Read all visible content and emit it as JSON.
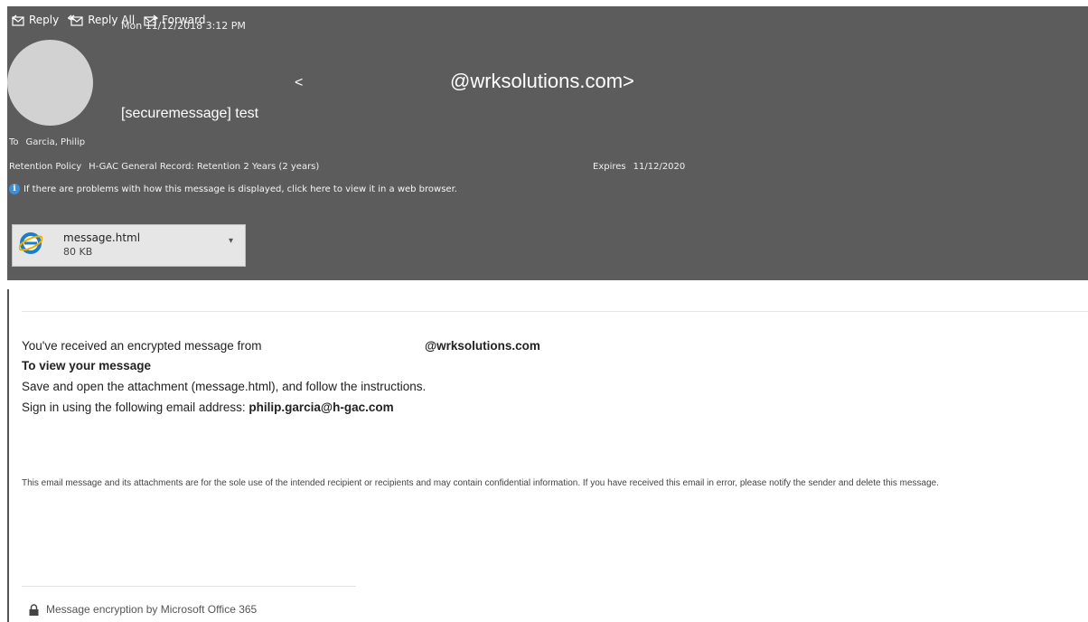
{
  "toolbar": {
    "reply_label": "Reply",
    "reply_all_label": "Reply All",
    "forward_label": "Forward"
  },
  "header": {
    "date": "Mon 11/12/2018 3:12 PM",
    "sender_open": "<",
    "sender_address": "@wrksolutions.com>",
    "subject": "[securemessage] test",
    "to_label": "To",
    "to_value": "Garcia, Philip",
    "retention_label": "Retention Policy",
    "retention_value": "H-GAC General Record: Retention 2 Years (2 years)",
    "expires_label": "Expires",
    "expires_value": "11/12/2020",
    "info_text": "If there are problems with how this message is displayed, click here to view it in a web browser.",
    "info_icon": "info-icon"
  },
  "attachment": {
    "name": "message.html",
    "size": "80 KB",
    "icon": "internet-explorer-icon"
  },
  "message": {
    "line1": "You've received an encrypted message from",
    "line1_sender": "@wrksolutions.com",
    "line2": "To view your message",
    "line3": "Save and open the attachment (message.html), and follow the instructions.",
    "line4_prefix": "Sign in using the following email address: ",
    "line4_email": "philip.garcia@h-gac.com",
    "disclaimer": "This email message and its attachments are for the sole use of the intended recipient or recipients and may contain confidential information. If you have received this email in error, please notify the sender and delete this message.",
    "footer": "Message encryption by Microsoft Office 365"
  },
  "colors": {
    "header_bg": "#5c5c5c",
    "avatar_bg": "#d2d2d2",
    "info_blue": "#3d8fd8"
  }
}
